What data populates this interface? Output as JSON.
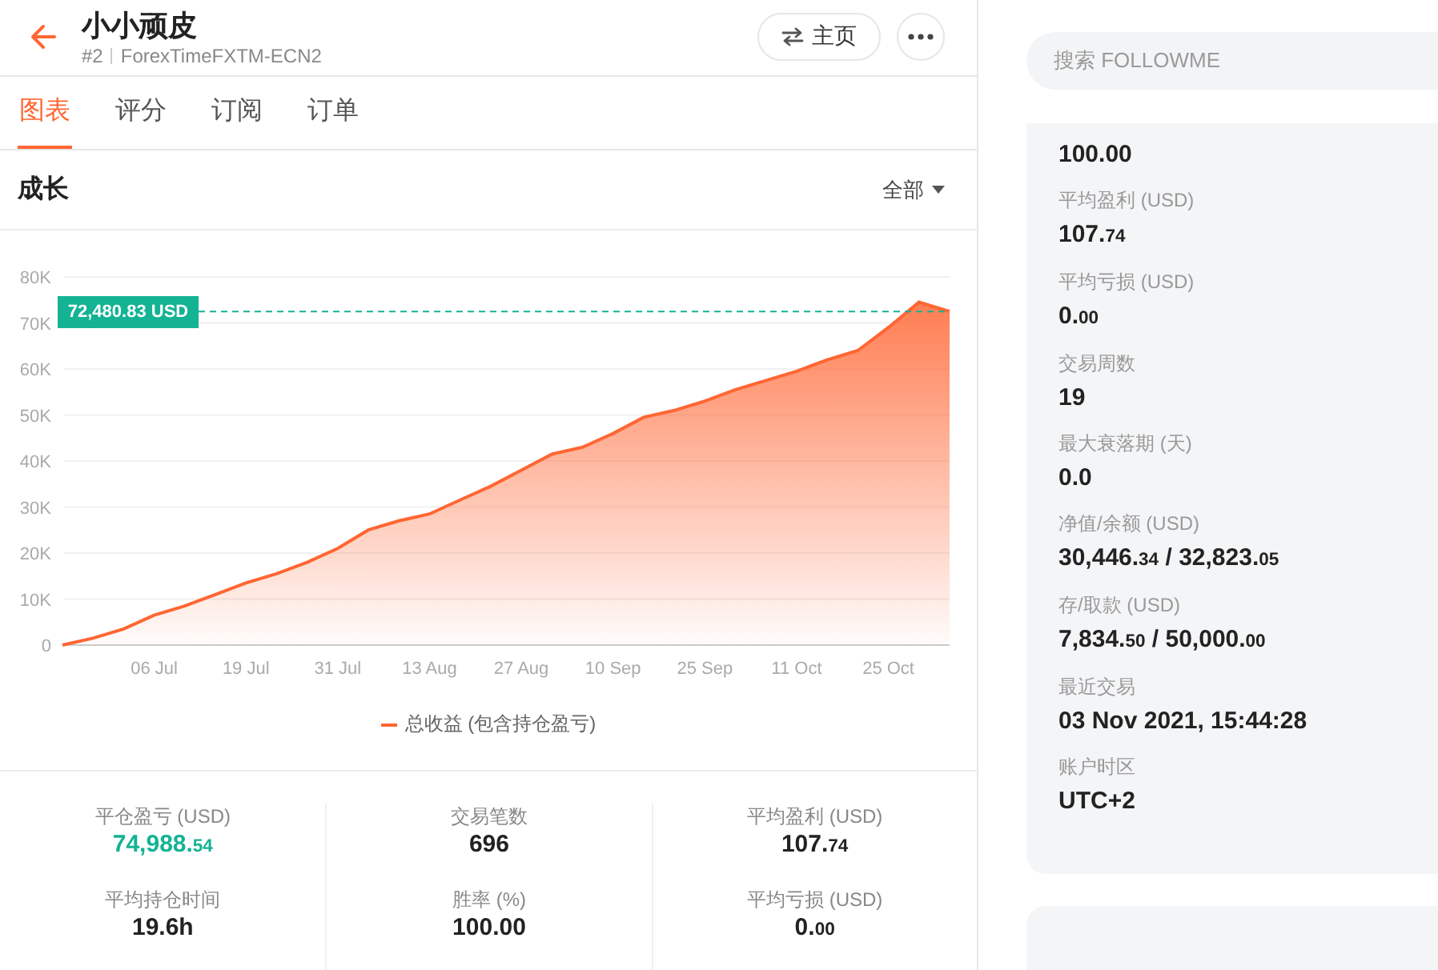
{
  "header": {
    "title": "小小顽皮",
    "rank": "#2",
    "server": "ForexTimeFXTM-ECN2",
    "home_button": "主页"
  },
  "tabs": [
    {
      "label": "图表",
      "selected": true
    },
    {
      "label": "评分",
      "selected": false
    },
    {
      "label": "订阅",
      "selected": false
    },
    {
      "label": "订单",
      "selected": false
    }
  ],
  "section": {
    "title": "成长",
    "filter": "全部"
  },
  "chart_data": {
    "type": "area",
    "categories": [
      null,
      null,
      null,
      "06 Jul",
      null,
      null,
      "19 Jul",
      null,
      null,
      "31 Jul",
      null,
      null,
      "13 Aug",
      null,
      null,
      "27 Aug",
      null,
      null,
      "10 Sep",
      null,
      null,
      "25 Sep",
      null,
      null,
      "11 Oct",
      null,
      null,
      "25 Oct",
      null,
      null
    ],
    "series": [
      {
        "name": "总收益 (包含持仓盈亏)",
        "color": "#ff6633",
        "values": [
          0,
          1500,
          3500,
          6500,
          8500,
          11000,
          13500,
          15500,
          18000,
          21000,
          25000,
          27000,
          28500,
          31500,
          34500,
          38000,
          41500,
          43000,
          46000,
          49500,
          51000,
          53000,
          55500,
          57500,
          59500,
          62000,
          64000,
          69000,
          74500,
          72500
        ]
      }
    ],
    "ylim": [
      0,
      80000
    ],
    "yticks": [
      {
        "value": 0,
        "label": "0"
      },
      {
        "value": 10000,
        "label": "10K"
      },
      {
        "value": 20000,
        "label": "20K"
      },
      {
        "value": 30000,
        "label": "30K"
      },
      {
        "value": 40000,
        "label": "40K"
      },
      {
        "value": 50000,
        "label": "50K"
      },
      {
        "value": 60000,
        "label": "60K"
      },
      {
        "value": 70000,
        "label": "70K"
      },
      {
        "value": 80000,
        "label": "80K"
      }
    ],
    "grid": true,
    "ref_lines": [
      {
        "axis": "y",
        "value": 72480.83,
        "label": "72,480.83 USD",
        "color": "#13b394"
      }
    ]
  },
  "stats": [
    {
      "label": "平仓盈亏 (USD)",
      "color": "#13b394",
      "value": [
        {
          "text": "74,988.",
          "small": false
        },
        {
          "text": "54",
          "small": true
        }
      ]
    },
    {
      "label": "交易笔数",
      "color": "#222222",
      "value": [
        {
          "text": "696",
          "small": false
        }
      ]
    },
    {
      "label": "平均盈利 (USD)",
      "color": "#222222",
      "value": [
        {
          "text": "107.",
          "small": false
        },
        {
          "text": "74",
          "small": true
        }
      ]
    },
    {
      "label": "平均持仓时间",
      "color": "#222222",
      "value": [
        {
          "text": "19.6h",
          "small": false
        }
      ]
    },
    {
      "label": "胜率 (%)",
      "color": "#222222",
      "value": [
        {
          "text": "100.00",
          "small": false
        }
      ]
    },
    {
      "label": "平均亏损 (USD)",
      "color": "#222222",
      "value": [
        {
          "text": "0.",
          "small": false
        },
        {
          "text": "00",
          "small": true
        }
      ]
    }
  ],
  "search": {
    "placeholder": "搜索 FOLLOWME"
  },
  "details": [
    {
      "value": [
        {
          "text": "100.00",
          "small": false
        }
      ]
    },
    {
      "label": "平均盈利 (USD)",
      "value": [
        {
          "text": "107.",
          "small": false
        },
        {
          "text": "74",
          "small": true
        }
      ]
    },
    {
      "label": "平均亏损 (USD)",
      "value": [
        {
          "text": "0.",
          "small": false
        },
        {
          "text": "00",
          "small": true
        }
      ]
    },
    {
      "label": "交易周数",
      "value": [
        {
          "text": "19",
          "small": false
        }
      ]
    },
    {
      "label": "最大衰落期 (天)",
      "value": [
        {
          "text": "0.0",
          "small": false
        }
      ]
    },
    {
      "label": "净值/余额 (USD)",
      "value": [
        {
          "text": "30,446.",
          "small": false
        },
        {
          "text": "34",
          "small": true
        },
        {
          "text": " / ",
          "small": false
        },
        {
          "text": "32,823.",
          "small": false
        },
        {
          "text": "05",
          "small": true
        }
      ]
    },
    {
      "label": "存/取款 (USD)",
      "value": [
        {
          "text": "7,834.",
          "small": false
        },
        {
          "text": "50",
          "small": true
        },
        {
          "text": " / ",
          "small": false
        },
        {
          "text": "50,000.",
          "small": false
        },
        {
          "text": "00",
          "small": true
        }
      ]
    },
    {
      "label": "最近交易",
      "value": [
        {
          "text": "03 Nov 2021, 15:44:28",
          "small": false
        }
      ]
    },
    {
      "label": "账户时区",
      "value": [
        {
          "text": "UTC+2",
          "small": false
        }
      ]
    }
  ]
}
